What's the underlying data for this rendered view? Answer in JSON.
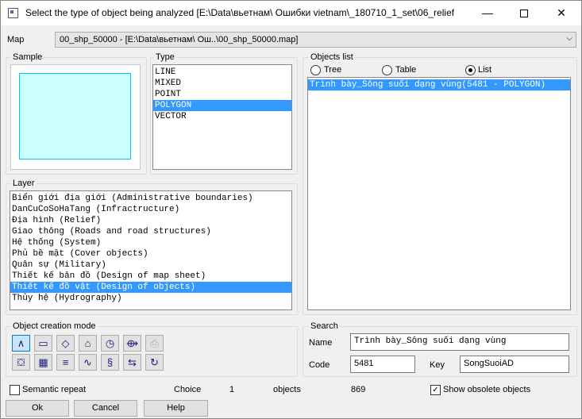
{
  "window": {
    "title": "Select the type of object being analyzed [E:\\Data\\вьетнам\\  Ошибки vietnam\\_180710_1_set\\06_relief\\vie...",
    "minimize_glyph": "—",
    "close_glyph": "✕"
  },
  "map": {
    "label": "Map",
    "value": "00_shp_50000 - [E:\\Data\\вьетнам\\  Ош..\\00_shp_50000.map]"
  },
  "sample": {
    "title": "Sample",
    "fill_color": "#ccffff",
    "border_color": "#00c8ff"
  },
  "type": {
    "title": "Type",
    "items": [
      "LINE",
      "MIXED",
      "POINT",
      "POLYGON",
      "VECTOR"
    ],
    "selected_index": 3
  },
  "objects_list": {
    "title": "Objects list",
    "radios": [
      {
        "label": "Tree",
        "checked": false
      },
      {
        "label": "Table",
        "checked": false
      },
      {
        "label": "List",
        "checked": true
      }
    ],
    "items": [
      "Trình bày_Sông suối dạng vùng(5481 - POLYGON)"
    ]
  },
  "layer": {
    "title": "Layer",
    "items": [
      "Biển giới địa giới (Administrative boundaries)",
      "DanCuCoSoHaTang (Infractructure)",
      "Địa hình (Relief)",
      "Giao thông (Roads and road structures)",
      "Hệ thống (System)",
      "Phủ bề mặt (Cover objects)",
      "Quân sự (Military)",
      "Thiết kế bản đồ (Design of map sheet)",
      "Thiết kế đồ vật (Design of objects)",
      "Thủy hệ (Hydrography)"
    ],
    "selected_index": 8
  },
  "creation_mode": {
    "title": "Object creation mode",
    "tools_row1": [
      {
        "icon": "polyline-icon",
        "glyph": "∧"
      },
      {
        "icon": "rectangle-icon",
        "glyph": "▭"
      },
      {
        "icon": "rotated-rectangle-icon",
        "glyph": "◇"
      },
      {
        "icon": "pentagon-icon",
        "glyph": "⌂"
      },
      {
        "icon": "circle-icon",
        "glyph": "◷"
      },
      {
        "icon": "circle-arrow-icon",
        "glyph": "⟴"
      },
      {
        "icon": "print-icon",
        "glyph": "⎙"
      }
    ],
    "tools_row2": [
      {
        "icon": "fill-icon",
        "glyph": "⛋"
      },
      {
        "icon": "grid-icon",
        "glyph": "▦"
      },
      {
        "icon": "parallel-lines-icon",
        "glyph": "≡"
      },
      {
        "icon": "curve-icon",
        "glyph": "∿"
      },
      {
        "icon": "s-curve-icon",
        "glyph": "§"
      },
      {
        "icon": "parallel-arrows-icon",
        "glyph": "⇆"
      },
      {
        "icon": "rotate-icon",
        "glyph": "↻"
      }
    ]
  },
  "search": {
    "title": "Search",
    "name_label": "Name",
    "name_value": "Trình bày_Sông suối dạng vùng",
    "code_label": "Code",
    "code_value": "5481",
    "key_label": "Key",
    "key_value": "SongSuoiAD"
  },
  "status": {
    "semantic_repeat": "Semantic repeat",
    "choice_label": "Choice",
    "choice_value": "1",
    "objects_label": "objects",
    "objects_value": "869",
    "show_obsolete": "Show obsolete objects",
    "show_obsolete_checked": true
  },
  "buttons": {
    "ok": "Ok",
    "cancel": "Cancel",
    "help": "Help"
  }
}
